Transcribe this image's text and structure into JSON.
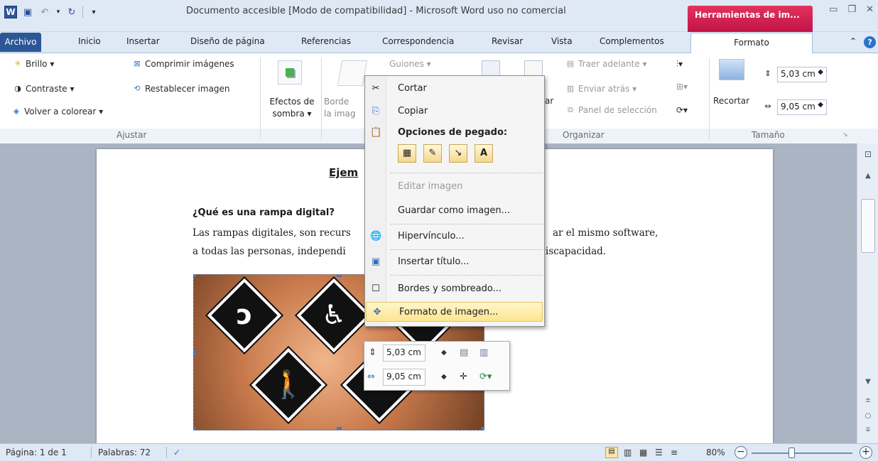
{
  "window": {
    "title": "Documento accesible [Modo de compatibilidad] - Microsoft Word uso no comercial",
    "context_tab_title": "Herramientas de im..."
  },
  "tabs": [
    {
      "label": "Archivo",
      "active": false
    },
    {
      "label": "Inicio"
    },
    {
      "label": "Insertar"
    },
    {
      "label": "Diseño de página"
    },
    {
      "label": "Referencias"
    },
    {
      "label": "Correspondencia"
    },
    {
      "label": "Revisar"
    },
    {
      "label": "Vista"
    },
    {
      "label": "Complementos"
    },
    {
      "label": "Formato",
      "active": true
    }
  ],
  "ribbon": {
    "ajustar": {
      "brillo": "Brillo ▾",
      "contraste": "Contraste ▾",
      "volver_colorear": "Volver a colorear ▾",
      "comprimir": "Comprimir imágenes",
      "restablecer": "Restablecer imagen",
      "label": "Ajustar"
    },
    "efectos": {
      "line1": "Efectos de",
      "line2": "sombra ▾"
    },
    "borde": {
      "line1": "Borde",
      "line2": "la imag"
    },
    "organizar": {
      "traer": "Traer adelante ▾",
      "enviar": "Enviar atrás ▾",
      "panel": "Panel de selección",
      "label": "Organizar",
      "hidden_partial": "Guiones ▾"
    },
    "tamano": {
      "recortar": "Recortar",
      "height": "5,03 cm",
      "width": "9,05 cm",
      "label": "Tamaño"
    }
  },
  "document": {
    "heading": "Ejem",
    "question": "¿Qué es una rampa digital?",
    "line1_left": "Las rampas digitales, son recurs",
    "line1_right": "ar el mismo software,",
    "line2_left": "a todas las personas, independi",
    "line2_right": "iscapacidad."
  },
  "context_menu": {
    "items": [
      {
        "label": "Cortar",
        "icon": "scissors-icon"
      },
      {
        "label": "Copiar",
        "icon": "copy-icon"
      },
      {
        "label": "Editar imagen",
        "disabled": true
      },
      {
        "label": "Guardar como imagen..."
      },
      {
        "label": "Hipervínculo...",
        "icon": "hyperlink-icon"
      },
      {
        "label": "Insertar título...",
        "icon": "caption-icon"
      },
      {
        "label": "Bordes y sombreado...",
        "icon": "borders-icon"
      },
      {
        "label": "Formato de imagen...",
        "icon": "format-picture-icon",
        "highlighted": true
      }
    ],
    "paste_header": "Opciones de pegado:",
    "paste_option_letter": "A"
  },
  "mini_toolbar": {
    "height": "5,03 cm",
    "width": "9,05 cm"
  },
  "status_bar": {
    "page": "Página: 1 de 1",
    "words": "Palabras: 72",
    "zoom": "80%"
  }
}
